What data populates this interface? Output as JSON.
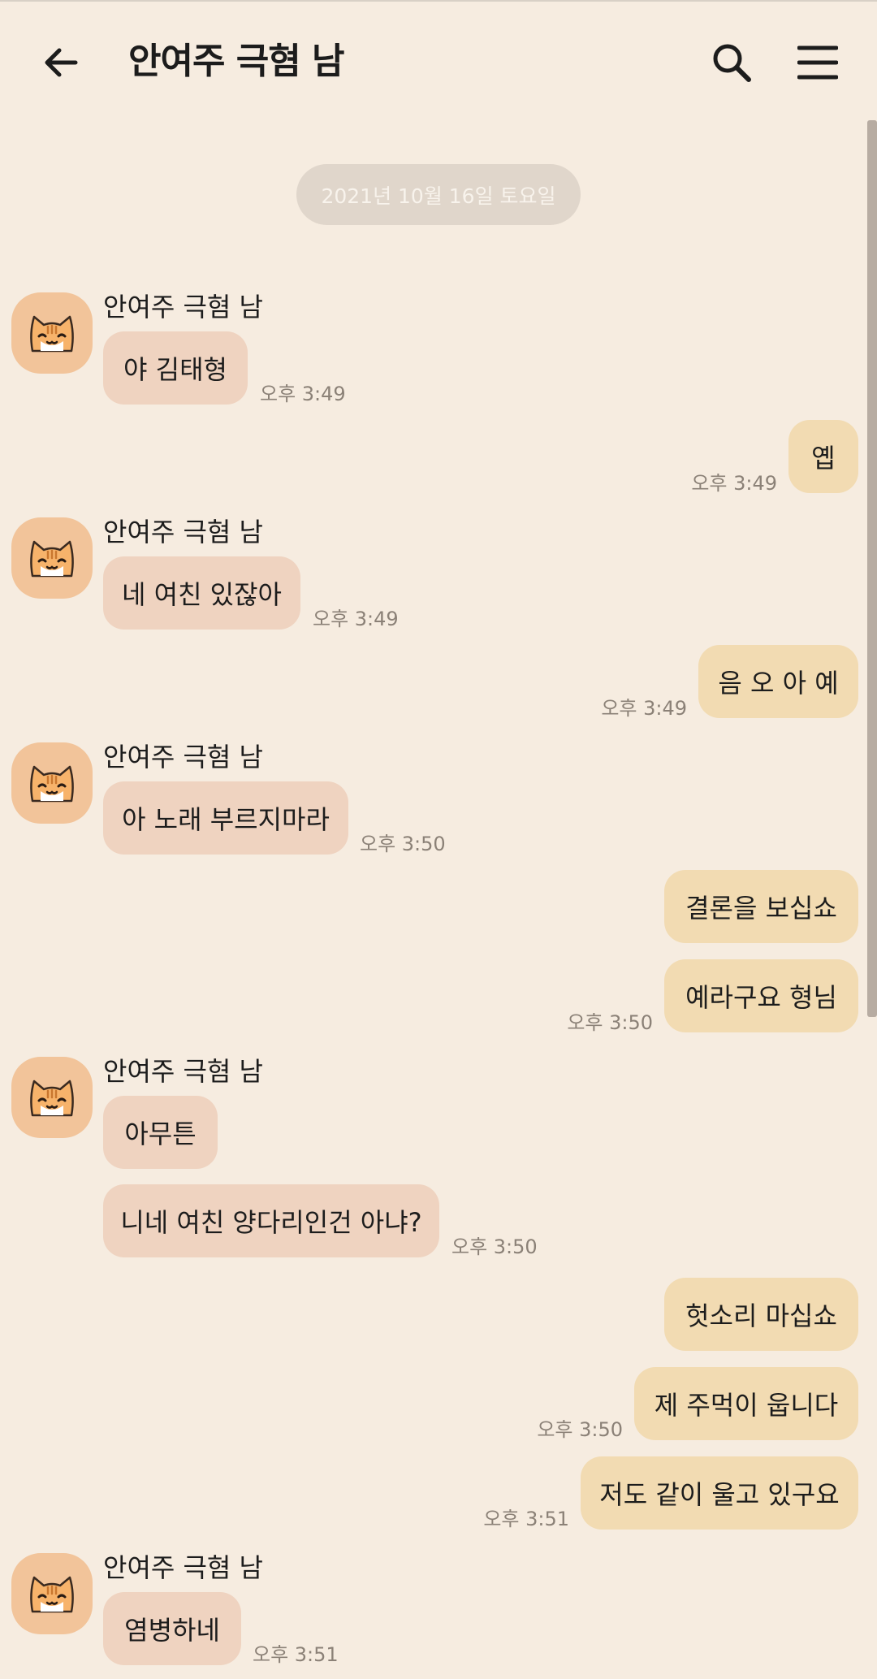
{
  "header": {
    "title": "안여주 극혐 남",
    "back_icon": "arrow-left-icon",
    "search_icon": "search-icon",
    "menu_icon": "hamburger-menu-icon"
  },
  "date_divider": "2021년 10월 16일 토요일",
  "sender_name": "안여주 극혐 남",
  "avatar_icon": "cat-face-icon",
  "messages": [
    {
      "dir": "in",
      "text": "야 김태형",
      "time": "오후 3:49"
    },
    {
      "dir": "out",
      "text": "옙",
      "time": "오후 3:49"
    },
    {
      "dir": "in",
      "text": "네 여친 있잖아",
      "time": "오후 3:49"
    },
    {
      "dir": "out",
      "text": "음 오 아 예",
      "time": "오후 3:49"
    },
    {
      "dir": "in",
      "text": "아 노래 부르지마라",
      "time": "오후 3:50"
    },
    {
      "dir": "out",
      "text": "결론을 보십쇼",
      "time": ""
    },
    {
      "dir": "out",
      "text": "예라구요 형님",
      "time": "오후 3:50"
    },
    {
      "dir": "in",
      "text": "아무튼",
      "time": ""
    },
    {
      "dir": "in",
      "text": "니네 여친 양다리인건 아냐?",
      "time": "오후 3:50"
    },
    {
      "dir": "out",
      "text": "헛소리 마십쇼",
      "time": ""
    },
    {
      "dir": "out",
      "text": "제 주먹이 웁니다",
      "time": "오후 3:50"
    },
    {
      "dir": "out",
      "text": "저도 같이 울고 있구요",
      "time": "오후 3:51"
    },
    {
      "dir": "in",
      "text": "염병하네",
      "time": "오후 3:51"
    }
  ],
  "colors": {
    "background": "#f6ece0",
    "incoming_bubble": "#efd3c0",
    "outgoing_bubble": "#f2dbb2",
    "avatar_bg": "#f2c49a",
    "date_pill": "#e0d6cb"
  }
}
